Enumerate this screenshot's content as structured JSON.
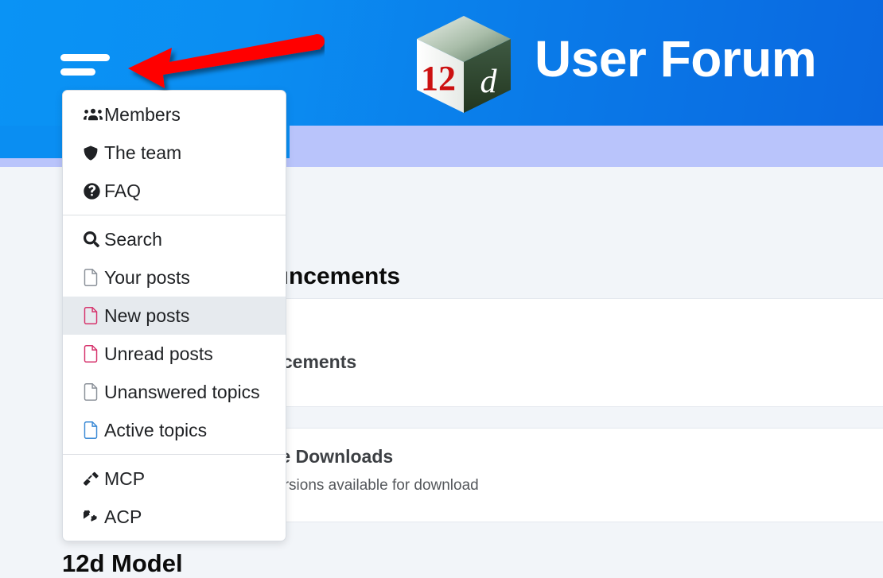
{
  "header": {
    "title": "User Forum",
    "logo_alt": "12d cube logo",
    "logo_text_left": "12",
    "logo_text_right": "d",
    "hamburger_name": "menu-toggle",
    "bg_color_start": "#0a93f5",
    "bg_color_end": "#0a68e0",
    "navbar_color": "#b9c4fb"
  },
  "annotation": {
    "arrow_color": "#ff0000",
    "points_to": "menu-toggle"
  },
  "menu": {
    "groups": [
      {
        "items": [
          {
            "label": "Members",
            "icon": "users-icon",
            "icon_color": "#1f2124",
            "active": false
          },
          {
            "label": "The team",
            "icon": "shield-icon",
            "icon_color": "#1f2124",
            "active": false
          },
          {
            "label": "FAQ",
            "icon": "question-circle-icon",
            "icon_color": "#1f2124",
            "active": false
          }
        ]
      },
      {
        "items": [
          {
            "label": "Search",
            "icon": "search-icon",
            "icon_color": "#1f2124",
            "active": false
          },
          {
            "label": "Your posts",
            "icon": "file-icon",
            "icon_color": "#8b9199",
            "active": false
          },
          {
            "label": "New posts",
            "icon": "file-icon",
            "icon_color": "#d6336c",
            "active": true
          },
          {
            "label": "Unread posts",
            "icon": "file-icon",
            "icon_color": "#d6336c",
            "active": false
          },
          {
            "label": "Unanswered topics",
            "icon": "file-icon",
            "icon_color": "#8b9199",
            "active": false
          },
          {
            "label": "Active topics",
            "icon": "file-icon",
            "icon_color": "#3d8bd6",
            "active": false
          }
        ]
      },
      {
        "items": [
          {
            "label": "MCP",
            "icon": "gavel-icon",
            "icon_color": "#1f2124",
            "active": false
          },
          {
            "label": "ACP",
            "icon": "cogs-icon",
            "icon_color": "#1f2124",
            "active": false
          }
        ]
      }
    ]
  },
  "content": {
    "section_1_title": "Announcements",
    "panel_1_heading": "Announcements",
    "panel_2_heading": "Software Downloads",
    "panel_2_subtext": "Current versions available for download",
    "section_2_title": "12d Model"
  }
}
